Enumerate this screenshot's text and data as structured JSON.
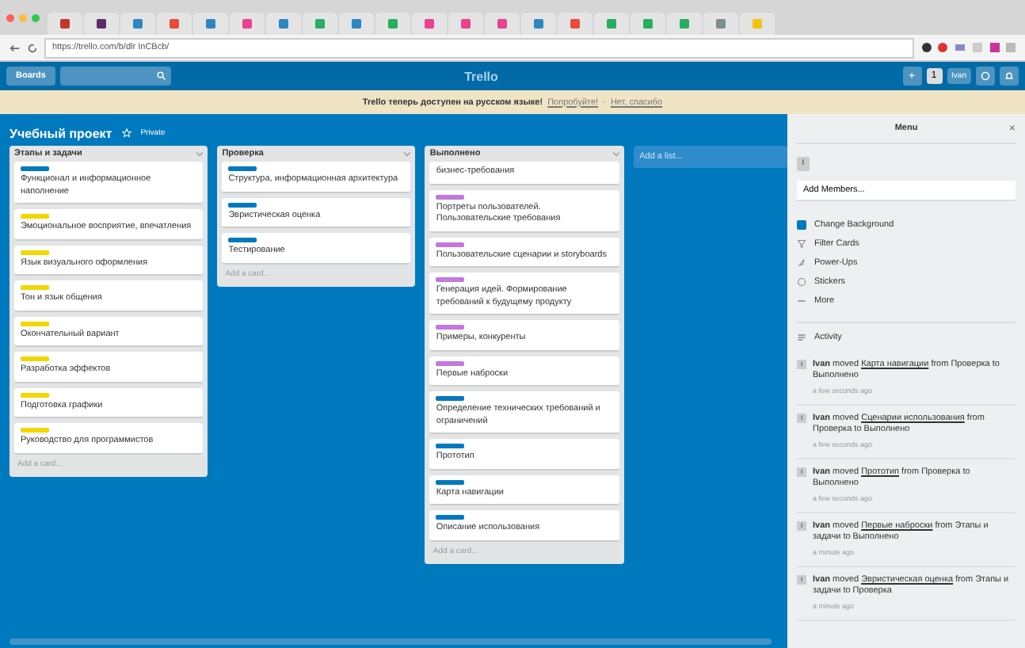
{
  "browser": {
    "url": "https://trello.com/b/dlr InCBcb/"
  },
  "header": {
    "boards_label": "Boards",
    "logo": "Trello",
    "add": "+",
    "avatar": "1",
    "user": "Ivan"
  },
  "banner": {
    "text": "Trello теперь доступен на русском языке!",
    "link": "Попробуйте!",
    "separator": "·",
    "dismiss": "Нет, спасибо"
  },
  "board": {
    "title": "Учебный проект",
    "visibility": "Private"
  },
  "lists": [
    {
      "title": "Этапы и задачи",
      "add": "Add a card...",
      "cards": [
        {
          "color": "#0079bf",
          "text": "Функционал и информационное наполнение"
        },
        {
          "color": "#f2d600",
          "text": "Эмоциональное восприятие, впечатления"
        },
        {
          "color": "#f2d600",
          "text": "Язык визуального оформления"
        },
        {
          "color": "#f2d600",
          "text": "Тон и язык общения"
        },
        {
          "color": "#f2d600",
          "text": "Окончательный вариант"
        },
        {
          "color": "#f2d600",
          "text": "Разработка эффектов"
        },
        {
          "color": "#f2d600",
          "text": "Подготовка графики"
        },
        {
          "color": "#f2d600",
          "text": "Руководство для программистов"
        }
      ]
    },
    {
      "title": "Проверка",
      "add": "Add a card...",
      "cards": [
        {
          "color": "#0079bf",
          "text": "Структура, информационная архитектура"
        },
        {
          "color": "#0079bf",
          "text": "Эвристическая оценка"
        },
        {
          "color": "#0079bf",
          "text": "Тестирование"
        }
      ]
    },
    {
      "title": "Выполнено",
      "add": "Add a card...",
      "cards": [
        {
          "text": "бизнес-требования"
        },
        {
          "color": "#c377e0",
          "text": "Портреты пользователей. Пользовательские требования"
        },
        {
          "color": "#c377e0",
          "text": "Пользовательские сценарии и storyboards"
        },
        {
          "color": "#c377e0",
          "text": "Генерация идей. Формирование требований к будущему продукту"
        },
        {
          "color": "#c377e0",
          "text": "Примеры, конкуренты"
        },
        {
          "color": "#c377e0",
          "text": "Первые наброски"
        },
        {
          "color": "#0079bf",
          "text": "Определение технических требований и ограничений"
        },
        {
          "color": "#0079bf",
          "text": "Прототип"
        },
        {
          "color": "#0079bf",
          "text": "Карта навигации"
        },
        {
          "color": "#0079bf",
          "text": "Описание использования"
        }
      ]
    }
  ],
  "add_list": "Add a list...",
  "menu": {
    "title": "Menu",
    "close": "×",
    "member_avatar": "I",
    "add_members": "Add Members...",
    "items": [
      {
        "kind": "background",
        "label": "Change Background"
      },
      {
        "kind": "filter",
        "label": "Filter Cards"
      },
      {
        "kind": "powerups",
        "label": "Power-Ups"
      },
      {
        "kind": "stickers",
        "label": "Stickers"
      },
      {
        "kind": "more",
        "label": "More"
      }
    ],
    "activity_title": "Activity",
    "activity": [
      {
        "avatar": "I",
        "user": "Ivan",
        "action": "moved",
        "card": "Карта навигации",
        "from": "from Проверка to Выполнено",
        "time": "a few seconds ago"
      },
      {
        "avatar": "I",
        "user": "Ivan",
        "action": "moved",
        "card": "Сценарии использования",
        "from": "from Проверка to Выполнено",
        "time": "a few seconds ago"
      },
      {
        "avatar": "I",
        "user": "Ivan",
        "action": "moved",
        "card": "Прототип",
        "from": "from Проверка to Выполнено",
        "time": "a few seconds ago"
      },
      {
        "avatar": "I",
        "user": "Ivan",
        "action": "moved",
        "card": "Первые наброски",
        "from": "from Этапы и задачи to Выполнено",
        "time": "a minute ago"
      },
      {
        "avatar": "I",
        "user": "Ivan",
        "action": "moved",
        "card": "Эвристическая оценка",
        "from": "from Этапы и задачи to Проверка",
        "time": "a minute ago"
      }
    ]
  }
}
